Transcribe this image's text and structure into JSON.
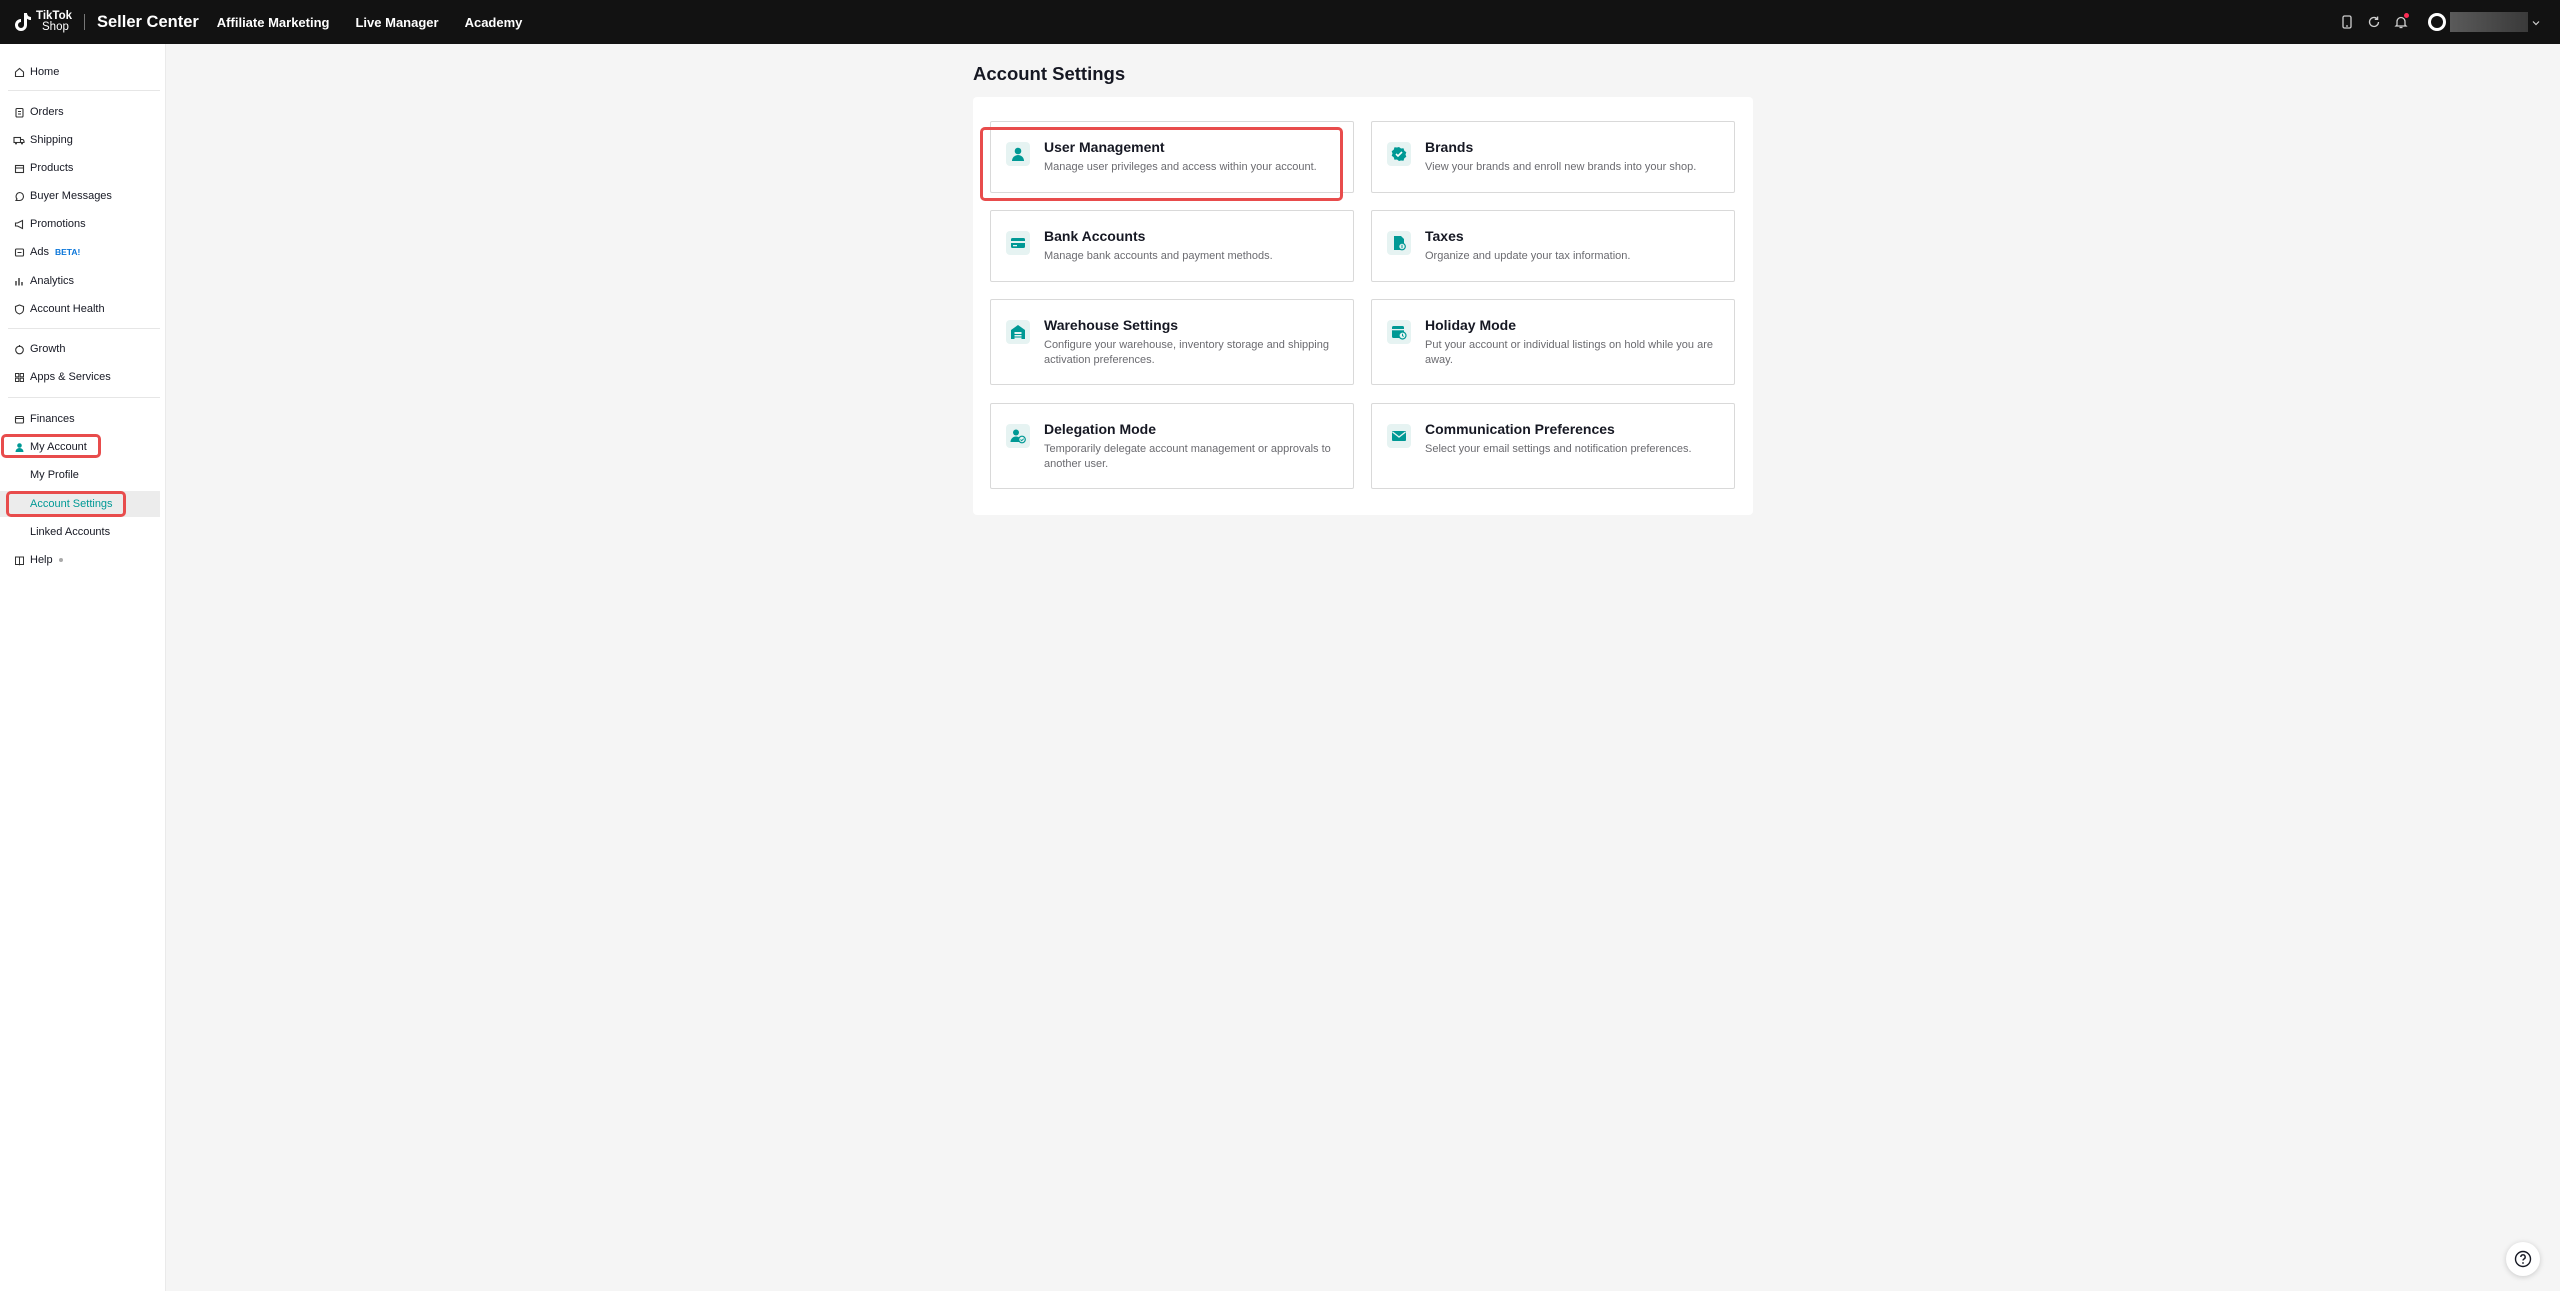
{
  "header": {
    "logo_line1": "TikTok",
    "logo_line2": "Shop",
    "app_title": "Seller Center",
    "nav": [
      "Affiliate Marketing",
      "Live Manager",
      "Academy"
    ]
  },
  "sidebar": {
    "items": [
      {
        "label": "Home",
        "icon": "home-icon"
      },
      {
        "label": "Orders",
        "icon": "clipboard-icon"
      },
      {
        "label": "Shipping",
        "icon": "truck-icon"
      },
      {
        "label": "Products",
        "icon": "box-icon"
      },
      {
        "label": "Buyer Messages",
        "icon": "chat-icon"
      },
      {
        "label": "Promotions",
        "icon": "megaphone-icon"
      },
      {
        "label": "Ads",
        "icon": "ads-icon",
        "badge": "BETA!"
      },
      {
        "label": "Analytics",
        "icon": "bar-chart-icon"
      },
      {
        "label": "Account Health",
        "icon": "shield-icon"
      },
      {
        "label": "Growth",
        "icon": "growth-icon"
      },
      {
        "label": "Apps & Services",
        "icon": "apps-icon"
      },
      {
        "label": "Finances",
        "icon": "wallet-icon"
      },
      {
        "label": "My Account",
        "icon": "user-icon"
      },
      {
        "label": "My Profile"
      },
      {
        "label": "Account Settings"
      },
      {
        "label": "Linked Accounts"
      },
      {
        "label": "Help",
        "icon": "book-icon"
      }
    ]
  },
  "main": {
    "title": "Account Settings",
    "cards": [
      {
        "title": "User Management",
        "desc": "Manage user privileges and access within your account.",
        "icon": "user-icon"
      },
      {
        "title": "Brands",
        "desc": "View your brands and enroll new brands into your shop.",
        "icon": "verified-badge-icon"
      },
      {
        "title": "Bank Accounts",
        "desc": "Manage bank accounts and payment methods.",
        "icon": "credit-card-icon"
      },
      {
        "title": "Taxes",
        "desc": "Organize and update your tax information.",
        "icon": "tax-document-icon"
      },
      {
        "title": "Warehouse Settings",
        "desc": "Configure your warehouse, inventory storage and shipping activation preferences.",
        "icon": "warehouse-icon"
      },
      {
        "title": "Holiday Mode",
        "desc": "Put your account or individual listings on hold while you are away.",
        "icon": "holiday-calendar-icon"
      },
      {
        "title": "Delegation Mode",
        "desc": "Temporarily delegate account management or approvals to another user.",
        "icon": "delegate-user-icon"
      },
      {
        "title": "Communication Preferences",
        "desc": "Select your email settings and notification preferences.",
        "icon": "envelope-icon"
      }
    ]
  },
  "colors": {
    "accent": "#009995",
    "topbar": "#121212",
    "highlight": "#e84c4c"
  }
}
